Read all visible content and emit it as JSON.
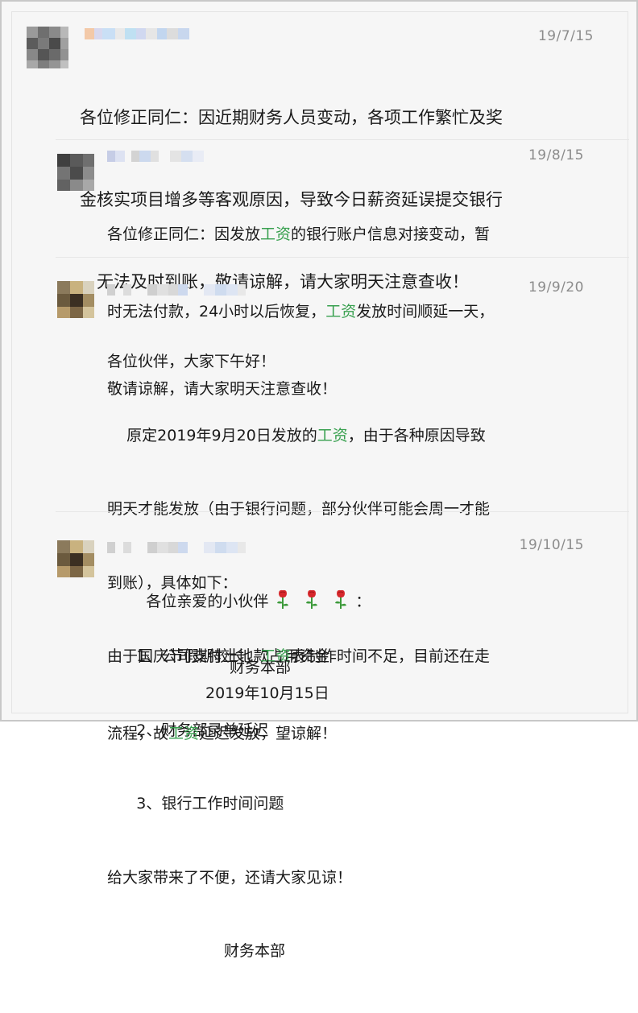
{
  "posts": [
    {
      "date": "19/7/15",
      "lines": [
        [
          {
            "t": "各位修正同仁：因近期财务人员变动，各项工作繁忙及奖"
          }
        ],
        [
          {
            "t": "金核实项目增多等客观原因，导致今日薪资延误提交银行"
          }
        ],
        [
          {
            "t": "，无法及时到账，敬请谅解，请大家明天注意查收！"
          }
        ]
      ]
    },
    {
      "date": "19/8/15",
      "lines": [
        [
          {
            "t": "各位修正同仁：因发放"
          },
          {
            "t": "工资",
            "hl": true
          },
          {
            "t": "的银行账户信息对接变动，暂"
          }
        ],
        [
          {
            "t": "时无法付款，24小时以后恢复，"
          },
          {
            "t": "工资",
            "hl": true
          },
          {
            "t": "发放时间顺延一天，"
          }
        ],
        [
          {
            "t": "敬请谅解，请大家明天注意查收！"
          }
        ]
      ]
    },
    {
      "date": "19/9/20",
      "lines": [
        [
          {
            "t": "各位伙伴，大家下午好！"
          }
        ],
        [
          {
            "t": "    原定2019年9月20日发放的"
          },
          {
            "t": "工资",
            "hl": true
          },
          {
            "t": "，由于各种原因导致"
          }
        ],
        [
          {
            "t": "明天才能发放（由于银行问题，部分伙伴可能会周一才能"
          }
        ],
        [
          {
            "t": "到账），具体如下："
          }
        ],
        [
          {
            "t": "      1、公司支付土地款占用资金"
          }
        ],
        [
          {
            "t": "      2、财务部录单延迟"
          }
        ],
        [
          {
            "t": "      3、银行工作时间问题"
          }
        ],
        [
          {
            "t": "给大家带来了不便，还请大家见谅！"
          }
        ],
        [
          {
            "t": "                        财务本部"
          }
        ]
      ]
    },
    {
      "date": "19/10/15",
      "greeting": "各位亲爱的小伙伴",
      "greeting_end": "：",
      "lines": [
        [
          {
            "t": "由于国庆节假期较长，"
          },
          {
            "t": "工资",
            "hl": true
          },
          {
            "t": "表制作时间不足，目前还在走"
          }
        ],
        [
          {
            "t": "流程，故"
          },
          {
            "t": "工资",
            "hl": true
          },
          {
            "t": "延迟发放，望谅解！"
          }
        ]
      ],
      "sign": "财务本部",
      "sign_date": "2019年10月15日"
    }
  ],
  "colors": {
    "highlight": "#38a04f",
    "date": "#8c8c8c",
    "text": "#1a1a1a"
  },
  "icons": {
    "rose": "rose-emoji-icon"
  }
}
